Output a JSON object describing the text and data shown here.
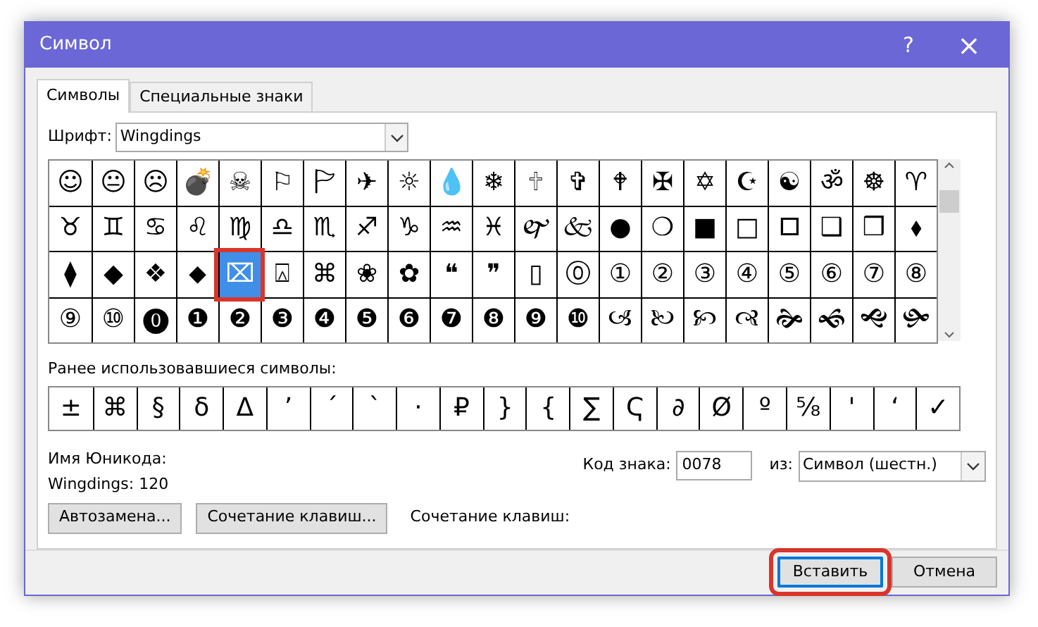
{
  "window": {
    "title": "Символ",
    "help": "?",
    "close": "×"
  },
  "tabs": [
    {
      "label": "Символы",
      "selected": true
    },
    {
      "label": "Специальные знаки",
      "selected": false
    }
  ],
  "font": {
    "label": "Шрифт:",
    "value": "Wingdings"
  },
  "symbol_grid": {
    "rows": [
      {
        "cells": [
          {
            "char": "☺",
            "selected": false
          },
          {
            "char": "😐",
            "selected": false
          },
          {
            "char": "☹",
            "selected": false
          },
          {
            "char": "💣",
            "selected": false
          },
          {
            "char": "☠",
            "selected": false
          },
          {
            "char": "⚐",
            "selected": false
          },
          {
            "char": "🏱",
            "selected": false
          },
          {
            "char": "✈",
            "selected": false
          },
          {
            "char": "☼",
            "selected": false
          },
          {
            "char": "💧",
            "selected": false
          },
          {
            "char": "❄",
            "selected": false
          },
          {
            "char": "🕆",
            "selected": false
          },
          {
            "char": "✞",
            "selected": false
          },
          {
            "char": "🕈",
            "selected": false
          },
          {
            "char": "✠",
            "selected": false
          },
          {
            "char": "✡",
            "selected": false
          },
          {
            "char": "☪",
            "selected": false
          },
          {
            "char": "☯",
            "selected": false
          },
          {
            "char": "ॐ",
            "selected": false
          },
          {
            "char": "☸",
            "selected": false
          },
          {
            "char": "♈",
            "selected": false
          }
        ]
      },
      {
        "cells": [
          {
            "char": "♉",
            "selected": false
          },
          {
            "char": "♊",
            "selected": false
          },
          {
            "char": "♋",
            "selected": false
          },
          {
            "char": "♌",
            "selected": false
          },
          {
            "char": "♍",
            "selected": false
          },
          {
            "char": "♎",
            "selected": false
          },
          {
            "char": "♏",
            "selected": false
          },
          {
            "char": "♐",
            "selected": false
          },
          {
            "char": "♑",
            "selected": false
          },
          {
            "char": "♒",
            "selected": false
          },
          {
            "char": "♓",
            "selected": false
          },
          {
            "char": "🙰",
            "selected": false
          },
          {
            "char": "🙵",
            "selected": false
          },
          {
            "char": "●",
            "selected": false
          },
          {
            "char": "❍",
            "selected": false
          },
          {
            "char": "■",
            "selected": false
          },
          {
            "char": "□",
            "selected": false
          },
          {
            "char": "🞐",
            "selected": false
          },
          {
            "char": "❑",
            "selected": false
          },
          {
            "char": "❒",
            "selected": false
          },
          {
            "char": "⬧",
            "selected": false
          }
        ]
      },
      {
        "cells": [
          {
            "char": "⧫",
            "selected": false
          },
          {
            "char": "◆",
            "selected": false
          },
          {
            "char": "❖",
            "selected": false
          },
          {
            "char": "⬥",
            "selected": false
          },
          {
            "char": "⌧",
            "selected": true
          },
          {
            "char": "⍓",
            "selected": false
          },
          {
            "char": "⌘",
            "selected": false
          },
          {
            "char": "❀",
            "selected": false
          },
          {
            "char": "✿",
            "selected": false
          },
          {
            "char": "❝",
            "selected": false
          },
          {
            "char": "❞",
            "selected": false
          },
          {
            "char": "▯",
            "selected": false
          },
          {
            "char": "⓪",
            "selected": false
          },
          {
            "char": "①",
            "selected": false
          },
          {
            "char": "②",
            "selected": false
          },
          {
            "char": "③",
            "selected": false
          },
          {
            "char": "④",
            "selected": false
          },
          {
            "char": "⑤",
            "selected": false
          },
          {
            "char": "⑥",
            "selected": false
          },
          {
            "char": "⑦",
            "selected": false
          },
          {
            "char": "⑧",
            "selected": false
          }
        ]
      },
      {
        "cells": [
          {
            "char": "⑨",
            "selected": false
          },
          {
            "char": "⑩",
            "selected": false
          },
          {
            "char": "⓿",
            "selected": false
          },
          {
            "char": "❶",
            "selected": false
          },
          {
            "char": "❷",
            "selected": false
          },
          {
            "char": "❸",
            "selected": false
          },
          {
            "char": "❹",
            "selected": false
          },
          {
            "char": "❺",
            "selected": false
          },
          {
            "char": "❻",
            "selected": false
          },
          {
            "char": "❼",
            "selected": false
          },
          {
            "char": "❽",
            "selected": false
          },
          {
            "char": "❾",
            "selected": false
          },
          {
            "char": "❿",
            "selected": false
          },
          {
            "char": "🙢",
            "selected": false
          },
          {
            "char": "🙠",
            "selected": false
          },
          {
            "char": "🙡",
            "selected": false
          },
          {
            "char": "🙣",
            "selected": false
          },
          {
            "char": "🙞",
            "selected": false
          },
          {
            "char": "🙜",
            "selected": false
          },
          {
            "char": "🙝",
            "selected": false
          },
          {
            "char": "🙟",
            "selected": false
          }
        ]
      }
    ]
  },
  "recent": {
    "label": "Ранее использовавшиеся символы:",
    "symbols": [
      "±",
      "⌘",
      "§",
      "δ",
      "Δ",
      "’",
      "´",
      "`",
      "·",
      "₽",
      "}",
      "{",
      "∑",
      "Ҁ",
      "∂",
      "Ø",
      "º",
      "⅝",
      "'",
      "‘",
      "✓"
    ]
  },
  "unicode_name": {
    "label": "Имя Юникода:",
    "value": "Wingdings: 120"
  },
  "char_code": {
    "label": "Код знака:",
    "value": "0078"
  },
  "from": {
    "label": "из:",
    "value": "Символ (шестн.)"
  },
  "buttons": [
    {
      "label": "Автозамена..."
    },
    {
      "label": "Сочетание клавиш..."
    }
  ],
  "shortcut": {
    "label": "Сочетание клавиш:"
  },
  "footer_buttons": [
    {
      "label": "Вставить",
      "default": true,
      "highlighted": true
    },
    {
      "label": "Отмена",
      "default": false,
      "highlighted": false
    }
  ]
}
